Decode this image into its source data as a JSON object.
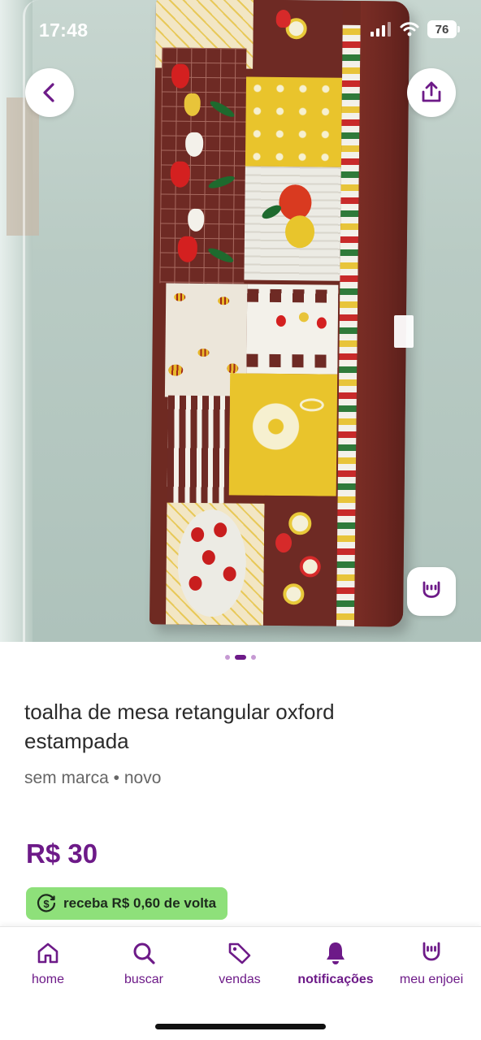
{
  "status_bar": {
    "time": "17:48",
    "battery": "76",
    "icons": [
      "signal-icon",
      "wifi-icon",
      "battery-icon"
    ]
  },
  "photo": {
    "pager": {
      "count": 3,
      "active_index": 1
    },
    "buttons": [
      "back-arrow-icon",
      "share-icon",
      "enjoei-hand-icon"
    ]
  },
  "product": {
    "title": "toalha de mesa retangular oxford estampada",
    "subtitle": "sem marca • novo",
    "price": "R$ 30",
    "cashback": "receba R$ 0,60 de volta"
  },
  "nav": {
    "items": [
      {
        "label": "home",
        "icon": "home-icon",
        "active": false
      },
      {
        "label": "buscar",
        "icon": "search-icon",
        "active": false
      },
      {
        "label": "vendas",
        "icon": "tag-icon",
        "active": false
      },
      {
        "label": "notificações",
        "icon": "bell-icon",
        "active": true
      },
      {
        "label": "meu enjoei",
        "icon": "enjoei-hand-icon",
        "active": false
      }
    ]
  },
  "colors": {
    "brand_purple": "#6d1a88",
    "cashback_green": "#8ee07a"
  }
}
